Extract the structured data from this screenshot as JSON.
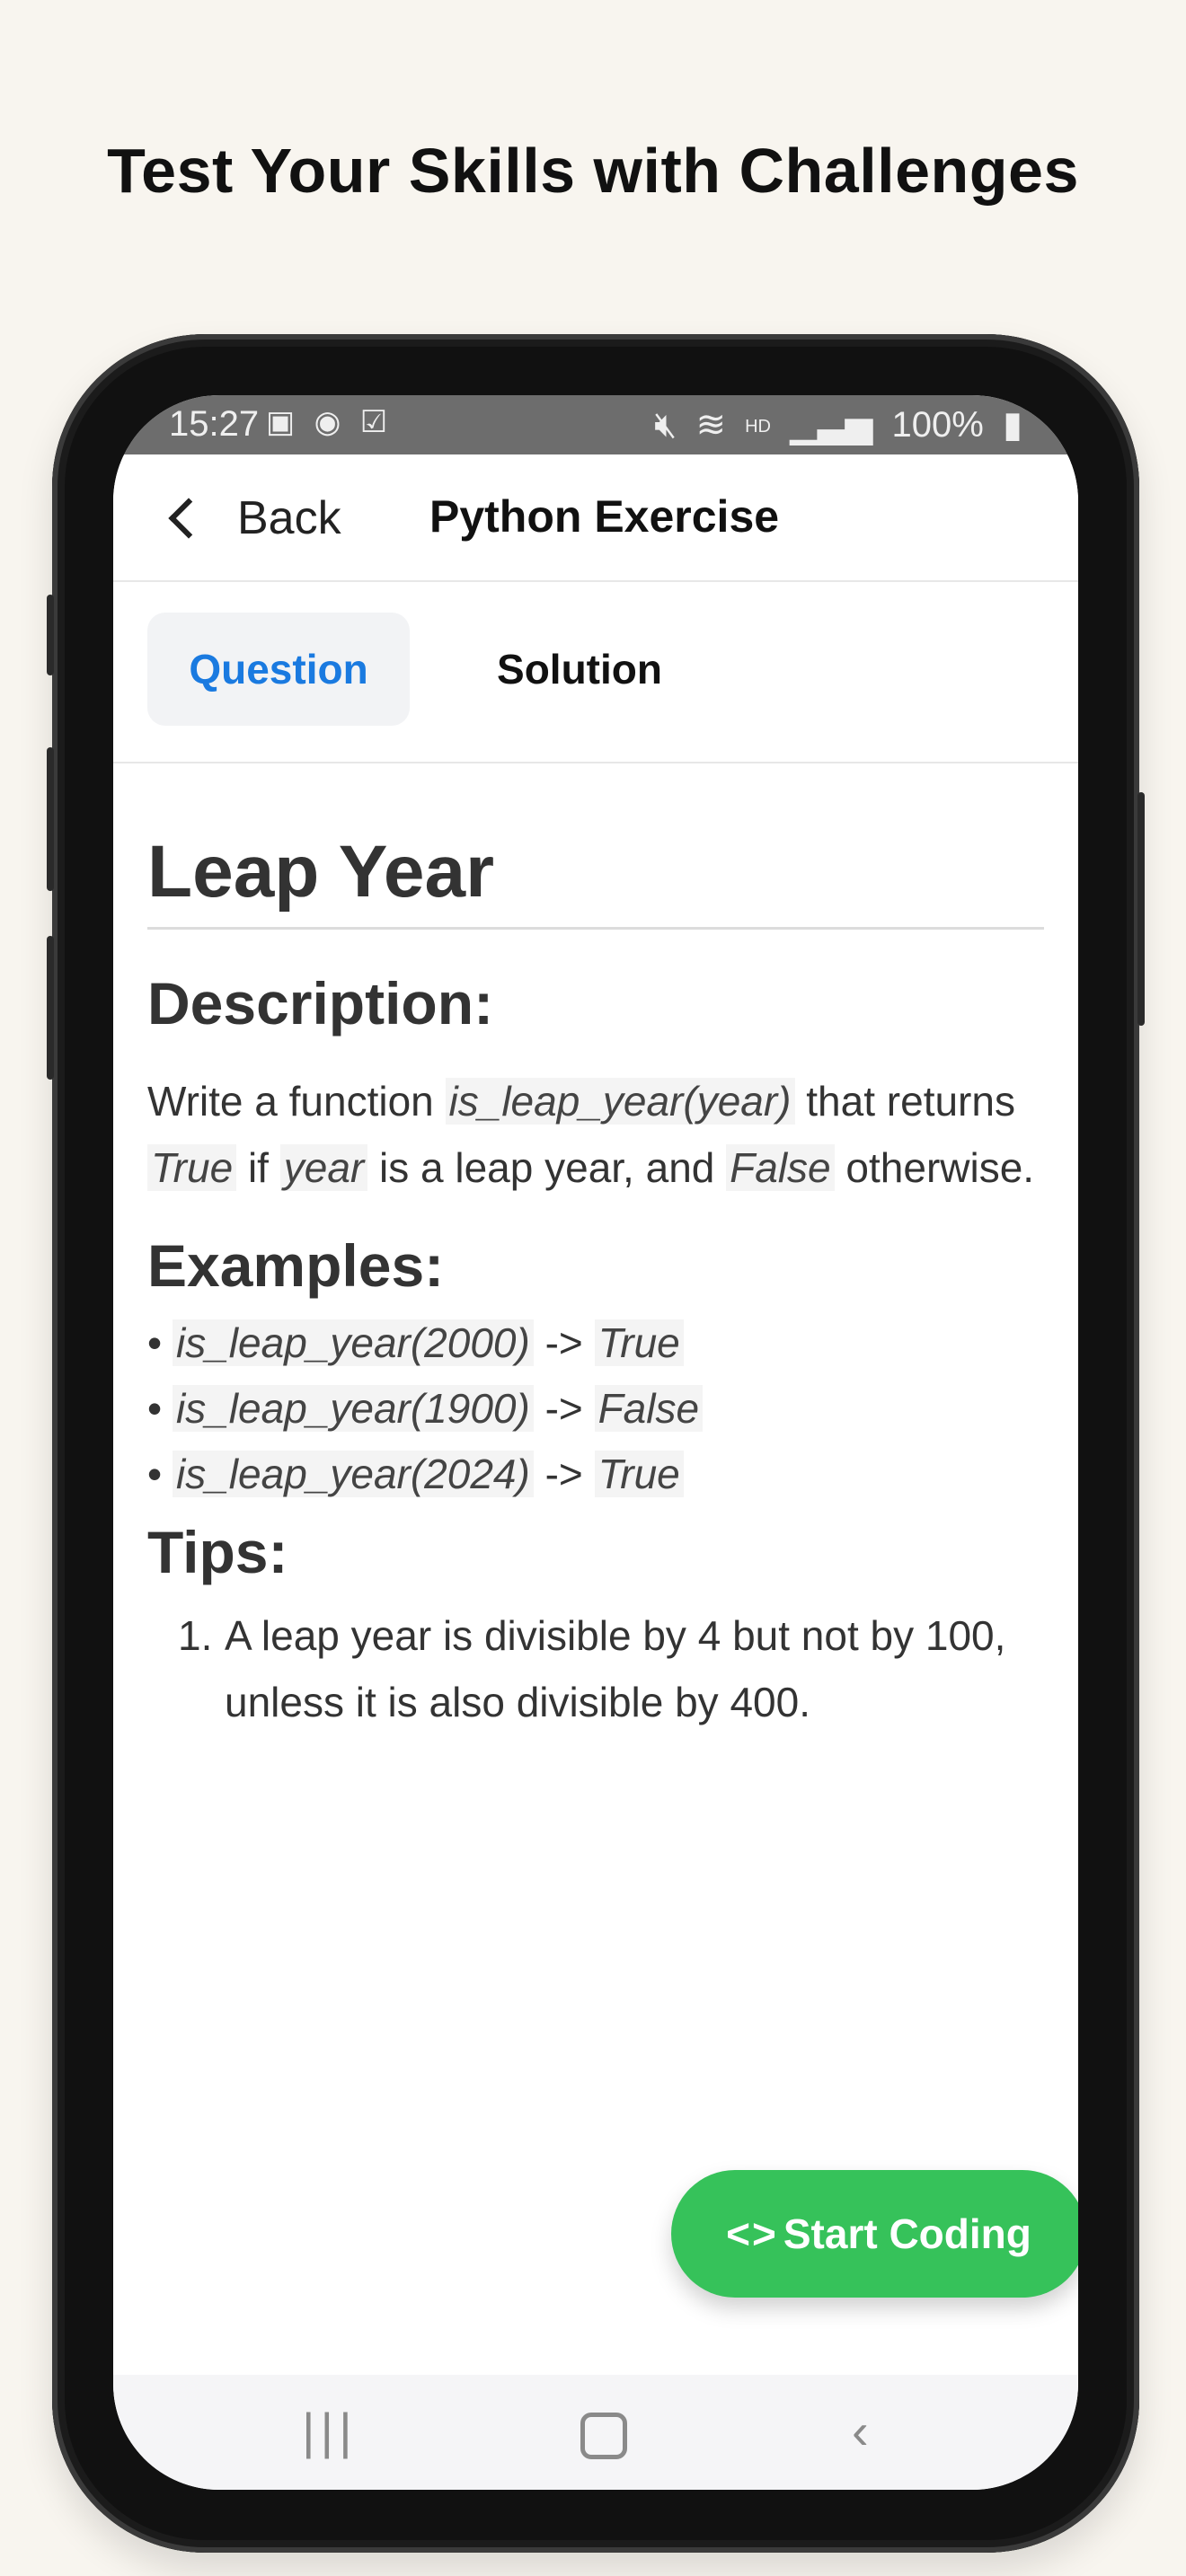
{
  "promo": {
    "title": "Test Your Skills with Challenges"
  },
  "status_bar": {
    "time": "15:27",
    "left_icons": [
      "image-icon",
      "sync-icon",
      "check-icon"
    ],
    "right_icons": [
      "mute-icon",
      "wifi-icon",
      "hd-icon",
      "signal-icon"
    ],
    "hd": "HD",
    "battery": "100%"
  },
  "nav": {
    "back_label": "Back",
    "title": "Python Exercise"
  },
  "tabs": [
    {
      "label": "Question",
      "active": true
    },
    {
      "label": "Solution",
      "active": false
    }
  ],
  "exercise": {
    "title": "Leap Year",
    "description_heading": "Description:",
    "description": {
      "t1": "Write a function ",
      "c1": "is_leap_year(year)",
      "t2": " that returns ",
      "c2": "True",
      "t3": " if ",
      "c3": "year",
      "t4": " is a leap year, and ",
      "c4": "False",
      "t5": " otherwise."
    },
    "examples_heading": "Examples:",
    "examples": [
      {
        "call": "is_leap_year(2000)",
        "arrow": " -> ",
        "result": "True"
      },
      {
        "call": "is_leap_year(1900)",
        "arrow": " -> ",
        "result": "False"
      },
      {
        "call": "is_leap_year(2024)",
        "arrow": " -> ",
        "result": "True"
      }
    ],
    "tips_heading": "Tips:",
    "tips": [
      {
        "num": "1.",
        "text": "A leap year is divisible by 4 but not by 100, unless it is also divisible by 400."
      }
    ]
  },
  "fab": {
    "icon": "<>",
    "label": "Start Coding"
  },
  "system_nav": {
    "recent": "|||",
    "back": "‹"
  },
  "colors": {
    "accent": "#1a7ae0",
    "fab": "#36c25a",
    "background": "#f8f5ef"
  }
}
